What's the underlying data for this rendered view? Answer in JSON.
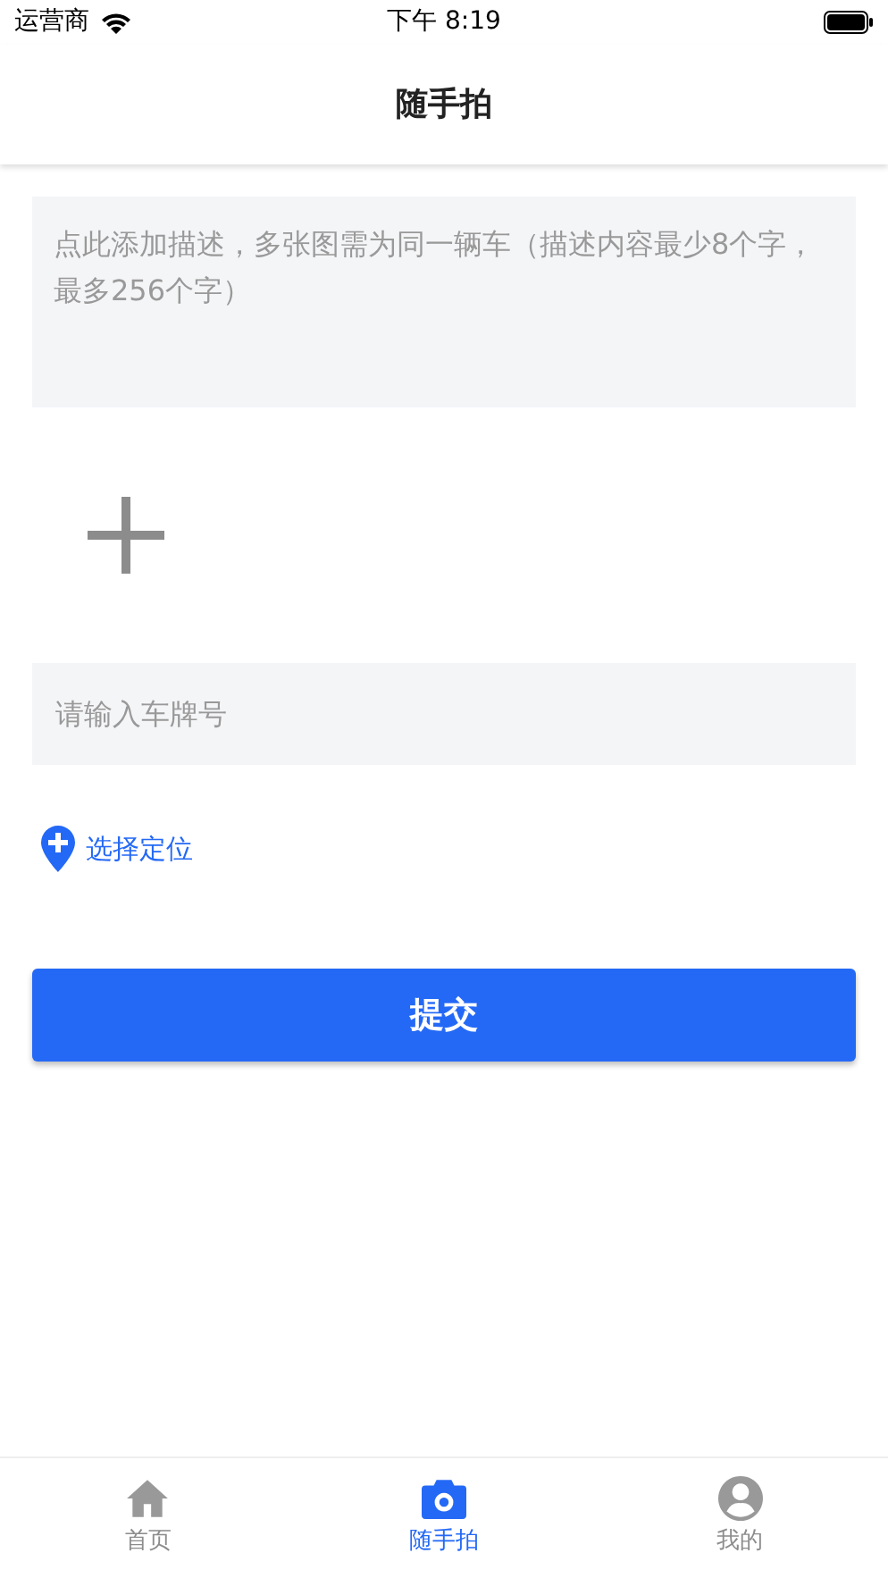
{
  "status_bar": {
    "carrier": "运营商",
    "time": "下午 8:19"
  },
  "header": {
    "title": "随手拍"
  },
  "description": {
    "placeholder": "点此添加描述，多张图需为同一辆车（描述内容最少8个字，最多256个字）"
  },
  "plate": {
    "placeholder": "请输入车牌号"
  },
  "location": {
    "label": "选择定位"
  },
  "submit": {
    "label": "提交"
  },
  "tabs": [
    {
      "kind": "home",
      "label": "首页",
      "selected": false
    },
    {
      "kind": "camera",
      "label": "随手拍",
      "selected": true
    },
    {
      "kind": "person",
      "label": "我的",
      "selected": false
    }
  ]
}
